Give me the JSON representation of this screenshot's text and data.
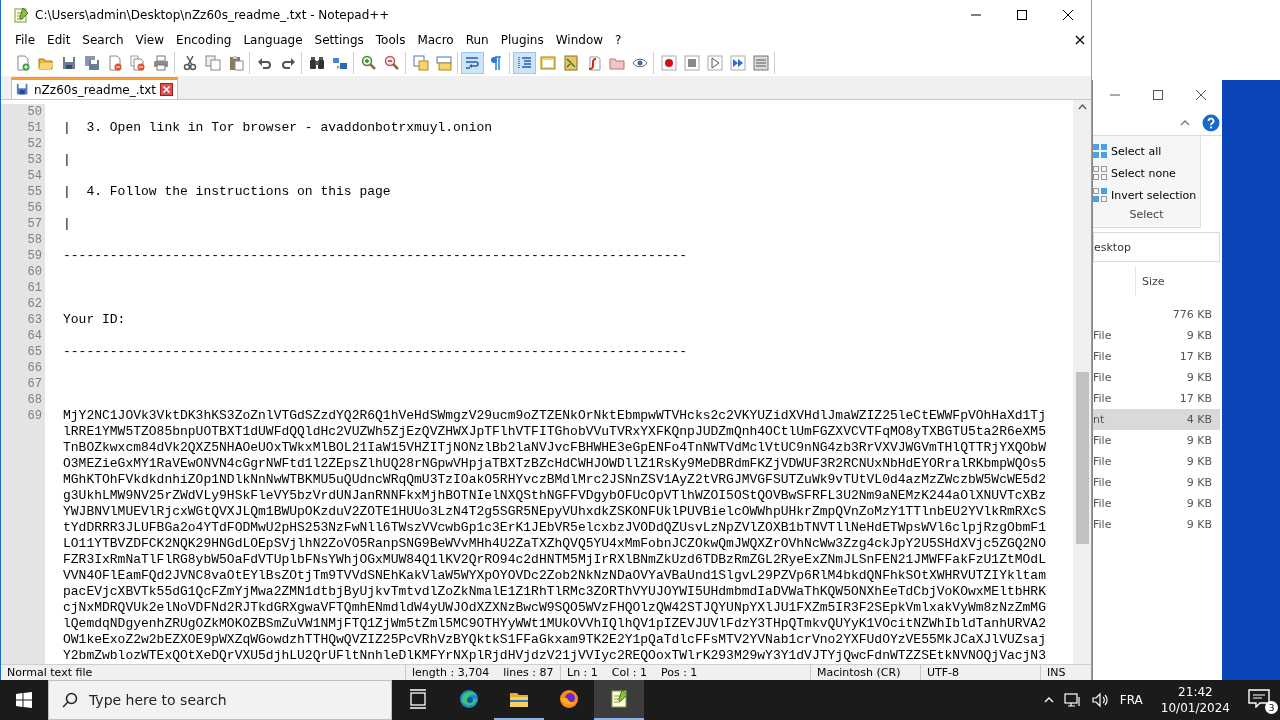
{
  "window": {
    "title": "C:\\Users\\admin\\Desktop\\nZz60s_readme_.txt - Notepad++"
  },
  "menu": [
    "File",
    "Edit",
    "Search",
    "View",
    "Encoding",
    "Language",
    "Settings",
    "Tools",
    "Macro",
    "Run",
    "Plugins",
    "Window",
    "?"
  ],
  "toolbar": [
    [
      {
        "kind": "new",
        "pressed": false
      },
      {
        "kind": "open",
        "pressed": false
      },
      {
        "kind": "save",
        "pressed": false
      },
      {
        "kind": "save-all",
        "pressed": false
      },
      {
        "kind": "close",
        "pressed": false
      },
      {
        "kind": "close-all",
        "pressed": false
      },
      {
        "kind": "print",
        "pressed": false
      }
    ],
    [
      {
        "kind": "cut",
        "pressed": false
      },
      {
        "kind": "copy",
        "pressed": false
      },
      {
        "kind": "paste",
        "pressed": false
      }
    ],
    [
      {
        "kind": "undo",
        "pressed": false
      },
      {
        "kind": "redo",
        "pressed": false
      }
    ],
    [
      {
        "kind": "find",
        "pressed": false
      },
      {
        "kind": "replace",
        "pressed": false
      }
    ],
    [
      {
        "kind": "zoom-in",
        "pressed": false
      },
      {
        "kind": "zoom-out",
        "pressed": false
      }
    ],
    [
      {
        "kind": "sync-v",
        "pressed": false
      },
      {
        "kind": "sync-h",
        "pressed": false
      }
    ],
    [
      {
        "kind": "wrap",
        "pressed": true
      },
      {
        "kind": "pilcrow",
        "pressed": false
      }
    ],
    [
      {
        "kind": "indent",
        "pressed": true
      },
      {
        "kind": "window",
        "pressed": false
      },
      {
        "kind": "map",
        "pressed": false
      },
      {
        "kind": "function",
        "pressed": false
      },
      {
        "kind": "folder",
        "pressed": false
      },
      {
        "kind": "eye",
        "pressed": false
      }
    ],
    [
      {
        "kind": "record",
        "pressed": false
      },
      {
        "kind": "stop",
        "pressed": false
      },
      {
        "kind": "play",
        "pressed": false
      },
      {
        "kind": "play-multi",
        "pressed": false
      },
      {
        "kind": "macro-list",
        "pressed": false
      }
    ]
  ],
  "tabs": [
    {
      "label": "nZz60s_readme_.txt",
      "selected": true
    }
  ],
  "editor": {
    "lines": [
      {
        "number": "50"
      },
      {
        "number": "51",
        "text": "|  3. Open link in Tor browser - avaddonbotrxmuyl.onion"
      },
      {
        "number": "52"
      },
      {
        "number": "53",
        "text": "|"
      },
      {
        "number": "54"
      },
      {
        "number": "55",
        "text": "|  4. Follow the instructions on this page"
      },
      {
        "number": "56"
      },
      {
        "number": "57",
        "text": "|"
      },
      {
        "number": "58"
      },
      {
        "number": "59",
        "text": "--------------------------------------------------------------------------------"
      },
      {
        "number": "60"
      },
      {
        "number": "61"
      },
      {
        "number": "62"
      },
      {
        "number": "63",
        "text": "Your ID:"
      },
      {
        "number": "64"
      },
      {
        "number": "65",
        "text": "--------------------------------------------------------------------------------"
      },
      {
        "number": "66"
      },
      {
        "number": "67"
      },
      {
        "number": "68"
      },
      {
        "number": "69",
        "rows": [
          "MjY2NC1JOVk3VktDK3hKS3ZoZnlVTGdSZzdYQ2R6Q1hVeHdSWmgzV29ucm9oZTZENkOrNktEbmpwWTVHcks2c2VKYUZidXVHdlJmaWZIZ25leCtEWWFpVOhHaXd1Tj",
          "lRRE1YMW5TZO85bnpUOTBXT1dUWFdQQldHc2VUZWh5ZjEzQVZHWXJpTFlhVTFITGhobVVuTVRxYXFKQnpJUDZmQnh4OCtlUmFGZXVCVTFqMO8yTXBGTU5ta2R6eXM5",
          "TnBOZkwxcm84dVk2QXZ5NHAOeUOxTWkxMlBOL21IaW15VHZITjNONzlBb2laNVJvcFBHWHE3eGpENFo4TnNWTVdMclVtUC9nNG4zb3RrVXVJWGVmTHlQTTRjYXQObW",
          "O3MEZieGxMY1RaVEwONVN4cGgrNWFtd1l2ZEpsZlhUQ28rNGpwVHpjaTBXTzBZcHdCWHJOWDllZ1RsKy9MeDBRdmFKZjVDWUF3R2RCNUxNbHdEYORralRKbmpWQOs5",
          "MGhKTOhFVkdkdnhiZOp1NDlkNnNwWTBKMU5uQUdncWRqQmU3TzIOakO5RHYvczBMdlMrc2JSNnZSV1AyZ2tVRGJMVGFSUTZuWk9vTUtVL0d4azMzZWczbW5WcWE5d2",
          "g3UkhLMW9NV25rZWdVLy9HSkFleVY5bzVrdUNJanRNNFkxMjhBOTNIelNXQSthNGFFVDgybOFUcOpVTlhWZOI5OStQOVBwSFRFL3U2Nm9aNEMzK244aOlXNUVTcXBz",
          "YWJBNVlMUEVlRjcxWGtQVXJLQm1BWUpOKzduV2ZOTE1HUUo3LzN4T2g5SGR5NEpyVUhxdkZSKONFUklPUVBielcOWWhpUHkrZmpQVnZoMzY1TTlnbEU2YVlkRmRXcS",
          "tYdDRRR3JLUFBGa2o4YTdFODMwU2pHS253NzFwNll6TWszVVcwbGp1c3ErK1JEbVR5elcxbzJVODdQZUsvLzNpZVlZOXB1bTNVTllNeHdETWpsWVl6clpjRzgObmF1",
          "LO11YTBVZDFCK2NQK29HNGdLOEpSVjlhN2ZoVO5RanpSNG9BeWVvMHh4U2ZaTXZhQVQ5YU4xMmFobnJCZOkwQmJWQXZrOVhNcWw3Zzg4ckJpY2U5SHdXVjc5ZGQ2NO",
          "FZR3IxRmNaTlFlRG8ybW5OaFdVTUplbFNsYWhjOGxMUW84Q1lKV2QrRO94c2dHNTM5MjIrRXlBNmZkUzd6TDBzRmZGL2RyeExZNmJLSnFEN21JMWFFakFzU1ZtMOdL",
          "VVN4OFlEamFQd2JVNC8vaOtEYlBsZOtjTm9TVVdSNEhKakVlaW5WYXpOYOVDc2Zob2NkNzNDaOVYaVBaUnd1SlgvL29PZVp6RlM4bkdQNFhkSOtXWHRVUTZIYkltam",
          "pacEVjcXBVTk55dG1QcFZmYjMwa2ZMN1dtbjByUjkvTmtvdlZoZkNmalE1Z1RhTlRMc3ZORThVYUJOYWI5UHdmbmdIaDVWaThKQW5ONXhEeTdCbjVoKOwxMEltbHRK",
          "cjNxMDRQVUk2elNoVDFNd2RJTkdGRXgwaVFTQmhENmdldW4yUWJOdXZXNzBwcW9SQO5WVzFHQOlzQW42STJQYUNpYXlJU1FXZm5IR3F2SEpkVmlxakVyWm8zNzZmMG",
          "lQemdqNDgyenhZRUgOZkMOKOZBSmZuVW1NMjFTQ1ZjWm5tZml5MC9OTHYyWWt1MUkOVVhIQlhQV1pIZEVJUVlFdzY3THpQTmkvQUYyK1VOcitNZWhIbldTanhURVA2",
          "OW1keExoZ2w2bEZXOE9pWXZqWGowdzhTTHQwQVZIZ25PcVRhVzBYQktkS1FFaGkxam9TK2E2Y1pQaTdlcFFsMTV2YVNab1crVno2YXFUdOYzVE55MkJCaXJlVUZsaj",
          "Y2bmZwblozWTExQOtXeDQrVXU5djhLU2QrUFltNnhleDlKMFYrNXplRjdHVjdzV21jVVIyc2REQOoxTWlrK293M29wY3Y1dVJTYjQwcFdnWTZZSEtkNVNOQjVacjN3"
        ]
      }
    ]
  },
  "status_bar": [
    "Normal text file",
    "length : 3,704    lines : 87",
    "Ln : 1    Col : 1    Pos : 1",
    "Macintosh (CR)",
    "UTF-8",
    "INS"
  ],
  "explorer": {
    "ribbon": [
      {
        "kind": "all",
        "label": "Select all"
      },
      {
        "kind": "none",
        "label": "Select none"
      },
      {
        "kind": "invert",
        "label": "Invert selection"
      }
    ],
    "group_label": "Select",
    "address": "esktop",
    "column": "Size",
    "rows": [
      {
        "size": "776 KB",
        "selected": false
      },
      {
        "type": "File",
        "size": "9 KB",
        "selected": false
      },
      {
        "type": "File",
        "size": "17 KB",
        "selected": false
      },
      {
        "type": "File",
        "size": "9 KB",
        "selected": false
      },
      {
        "type": "File",
        "size": "17 KB",
        "selected": false
      },
      {
        "type": "nt",
        "size": "4 KB",
        "selected": true
      },
      {
        "type": "File",
        "size": "9 KB",
        "selected": false
      },
      {
        "type": "File",
        "size": "9 KB",
        "selected": false
      },
      {
        "type": "File",
        "size": "9 KB",
        "selected": false
      },
      {
        "type": "File",
        "size": "9 KB",
        "selected": false
      },
      {
        "type": "File",
        "size": "9 KB",
        "selected": false
      }
    ]
  },
  "taskbar": {
    "search_placeholder": "Type here to search",
    "apps": [
      {
        "kind": "taskview",
        "running": false,
        "active": false
      },
      {
        "kind": "edge",
        "running": false,
        "active": false
      },
      {
        "kind": "explorer",
        "running": true,
        "active": false
      },
      {
        "kind": "firefox",
        "running": false,
        "active": false
      },
      {
        "kind": "notepad",
        "running": true,
        "active": true
      }
    ],
    "language": "FRA",
    "time": "21:42",
    "date": "10/01/2024",
    "notifications": "3"
  }
}
